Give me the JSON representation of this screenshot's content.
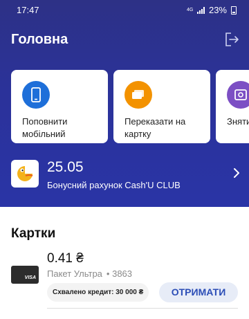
{
  "status_bar": {
    "time": "17:47",
    "network": "4G",
    "battery": "23%"
  },
  "header": {
    "title": "Головна",
    "logout_icon": "logout-icon"
  },
  "quick_actions": [
    {
      "label": "Поповнити\nмобільний",
      "icon": "phone-icon",
      "color": "#1e6fd9"
    },
    {
      "label": "Переказати на\nкартку",
      "icon": "card-transfer-icon",
      "color": "#f39200"
    },
    {
      "label": "Зняти",
      "icon": "safe-icon",
      "color": "#7c4fc4"
    }
  ],
  "bonus": {
    "amount": "25.05",
    "label": "Бонусний рахунок Cash'U CLUB",
    "logo_icon": "cashu-logo-icon"
  },
  "cards_section": {
    "title": "Картки",
    "cards": [
      {
        "brand": "VISA",
        "balance": "0.41 ₴",
        "name": "Пакет Ультра",
        "masked_number": "• 3863",
        "credit_text": "Схвалено кредит: 30 000 ₴",
        "action_label": "ОТРИМАТИ"
      }
    ]
  },
  "colors": {
    "header_gradient_top": "#2d3186",
    "header_gradient_bottom": "#2a34a6",
    "accent_button_text": "#2b4db6"
  }
}
